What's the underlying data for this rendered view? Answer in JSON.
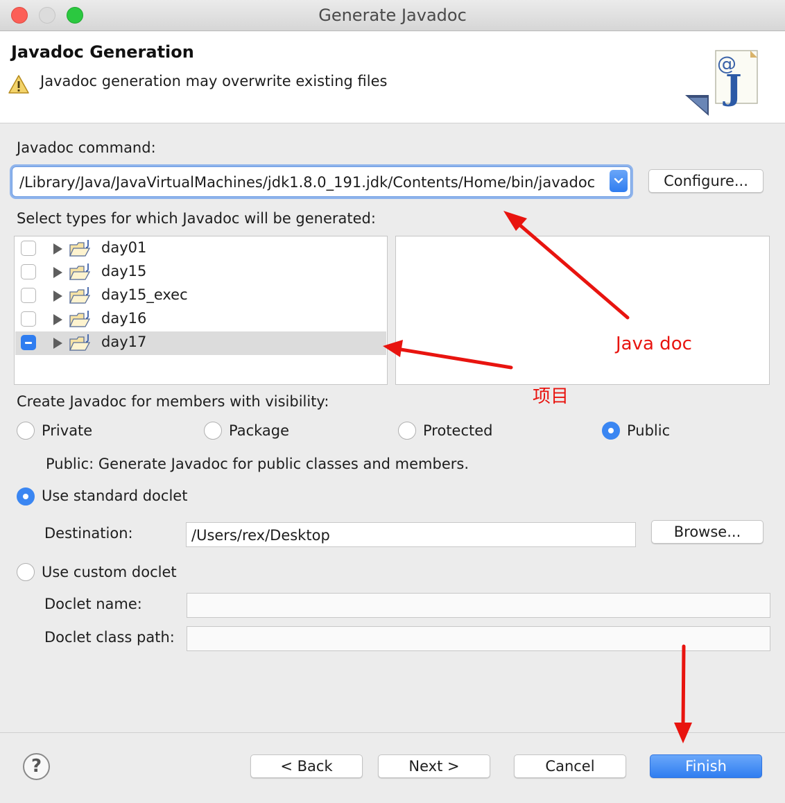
{
  "window": {
    "title": "Generate Javadoc"
  },
  "header": {
    "title": "Javadoc Generation",
    "message": "Javadoc generation may overwrite existing files"
  },
  "command": {
    "label": "Javadoc command:",
    "value": "/Library/Java/JavaVirtualMachines/jdk1.8.0_191.jdk/Contents/Home/bin/javadoc",
    "configure_label": "Configure..."
  },
  "types": {
    "label": "Select types for which Javadoc will be generated:",
    "items": [
      {
        "label": "day01",
        "state": "unchecked"
      },
      {
        "label": "day15",
        "state": "unchecked"
      },
      {
        "label": "day15_exec",
        "state": "unchecked"
      },
      {
        "label": "day16",
        "state": "unchecked"
      },
      {
        "label": "day17",
        "state": "mixed",
        "selected": true
      }
    ]
  },
  "visibility": {
    "label": "Create Javadoc for members with visibility:",
    "options": [
      "Private",
      "Package",
      "Protected",
      "Public"
    ],
    "selected": "Public",
    "description": "Public: Generate Javadoc for public classes and members."
  },
  "standard_doclet": {
    "label": "Use standard doclet",
    "selected": true,
    "destination_label": "Destination:",
    "destination_value": "/Users/rex/Desktop",
    "browse_label": "Browse..."
  },
  "custom_doclet": {
    "label": "Use custom doclet",
    "selected": false,
    "name_label": "Doclet name:",
    "name_value": "",
    "classpath_label": "Doclet class path:",
    "classpath_value": ""
  },
  "footer": {
    "help": "?",
    "back": "< Back",
    "next": "Next >",
    "cancel": "Cancel",
    "finish": "Finish"
  },
  "annotations": {
    "java_doc": "Java doc",
    "project": "项目",
    "color": "#e8140f"
  }
}
